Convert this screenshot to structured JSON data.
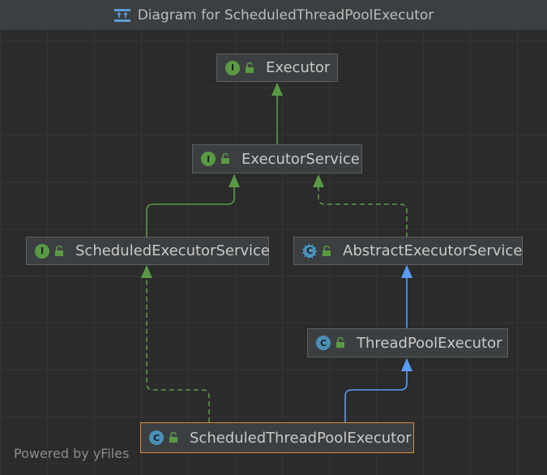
{
  "window": {
    "title": "Diagram for ScheduledThreadPoolExecutor",
    "icon": "diagram-icon"
  },
  "footer": {
    "text": "Powered by yFiles"
  },
  "colors": {
    "interface_badge": "#5a9a45",
    "class_badge": "#4a90b8",
    "extends_edge": "#589df6",
    "interface_edge": "#5a9a45",
    "selected_border": "#d88a3b"
  },
  "nodes": {
    "executor": {
      "label": "Executor",
      "kind": "interface",
      "badge": "I"
    },
    "executor_service": {
      "label": "ExecutorService",
      "kind": "interface",
      "badge": "I"
    },
    "scheduled_executor_service": {
      "label": "ScheduledExecutorService",
      "kind": "interface",
      "badge": "I"
    },
    "abstract_executor_service": {
      "label": "AbstractExecutorService",
      "kind": "abstract-class",
      "badge": "C"
    },
    "thread_pool_executor": {
      "label": "ThreadPoolExecutor",
      "kind": "class",
      "badge": "C"
    },
    "scheduled_thread_pool_executor": {
      "label": "ScheduledThreadPoolExecutor",
      "kind": "class",
      "badge": "C",
      "selected": true
    }
  },
  "edges": [
    {
      "from": "executor_service",
      "to": "executor",
      "type": "extends-interface"
    },
    {
      "from": "scheduled_executor_service",
      "to": "executor_service",
      "type": "extends-interface"
    },
    {
      "from": "abstract_executor_service",
      "to": "executor_service",
      "type": "implements"
    },
    {
      "from": "thread_pool_executor",
      "to": "abstract_executor_service",
      "type": "extends-class"
    },
    {
      "from": "scheduled_thread_pool_executor",
      "to": "thread_pool_executor",
      "type": "extends-class"
    },
    {
      "from": "scheduled_thread_pool_executor",
      "to": "scheduled_executor_service",
      "type": "implements"
    }
  ]
}
